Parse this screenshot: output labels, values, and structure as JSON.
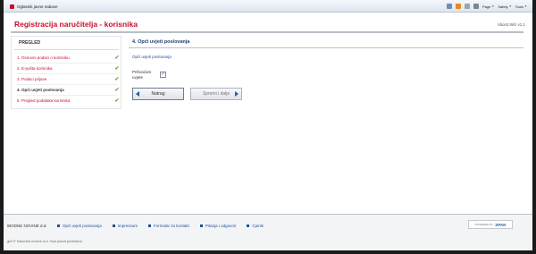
{
  "browser": {
    "tab_title": "Oglasnik javne nabave",
    "page_label": "Page",
    "safety_label": "Safety",
    "tools_label": "Tools"
  },
  "header": {
    "title": "Registracija naručitelja - korisnika",
    "version": "Idion3.Wiz v1.1"
  },
  "sidebar": {
    "title": "PREGLED",
    "steps": [
      {
        "label": "1. Osnovni podaci o korisniku",
        "done": true
      },
      {
        "label": "2. E-pošta korisnika",
        "done": true
      },
      {
        "label": "3. Podaci prijave",
        "done": true
      },
      {
        "label": "4. Opći uvjeti poslovanja",
        "done": true
      },
      {
        "label": "5. Pregled podataka korisnika",
        "done": true
      }
    ]
  },
  "main": {
    "section_title": "4. Opći uvjeti poslovanja",
    "terms_link": "Opći uvjeti poslovanja",
    "accept_label": "Prihvaćam uvjete",
    "accept_checked": true,
    "back_button": "Natrag",
    "next_button": "Spremi i dalje"
  },
  "footer": {
    "company": "IBODNE NOVINE d.d.",
    "links": [
      "Opći uvjeti poslovanja",
      "Impressum",
      "Formular za kontakt",
      "Pitanja i odgovori",
      "Cjenik"
    ],
    "copyright": "ght © Narodne novine d.d. Sva prava pridržana",
    "powered_by": "POWERED BY",
    "powered_brand": "SPAN"
  },
  "colors": {
    "brand_red": "#c8102e",
    "link_blue": "#1f4f9a",
    "check_green": "#6aa524"
  }
}
